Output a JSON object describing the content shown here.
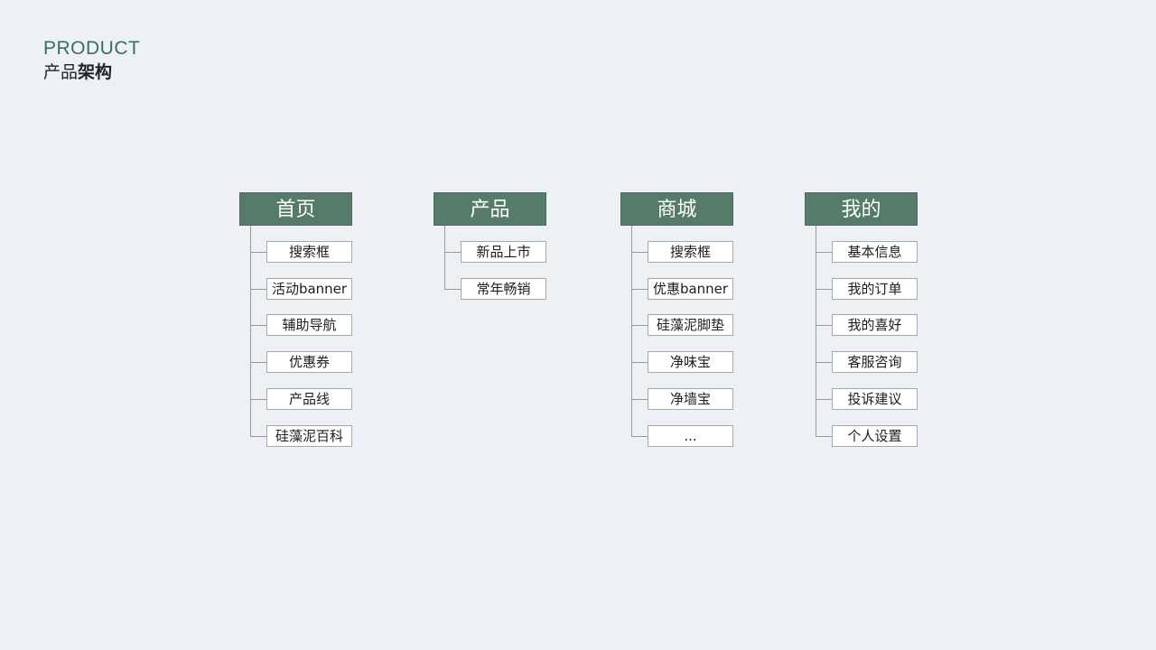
{
  "header": {
    "en": "PRODUCT",
    "zh_light": "产品",
    "zh_bold": "架构"
  },
  "columns": [
    {
      "title": "首页",
      "items": [
        "搜索框",
        "活动banner",
        "辅助导航",
        "优惠券",
        "产品线",
        "硅藻泥百科"
      ]
    },
    {
      "title": "产品",
      "items": [
        "新品上市",
        "常年畅销"
      ]
    },
    {
      "title": "商城",
      "items": [
        "搜索框",
        "优惠banner",
        "硅藻泥脚垫",
        "净味宝",
        "净墙宝",
        "..."
      ]
    },
    {
      "title": "我的",
      "items": [
        "基本信息",
        "我的订单",
        "我的喜好",
        "客服咨询",
        "投诉建议",
        "个人设置"
      ]
    }
  ],
  "colors": {
    "background": "#edf1f5",
    "header_accent": "#3b6f56",
    "node_fill": "#567b68",
    "leaf_border": "#a8a8a8",
    "connector": "#9a9a9a"
  }
}
